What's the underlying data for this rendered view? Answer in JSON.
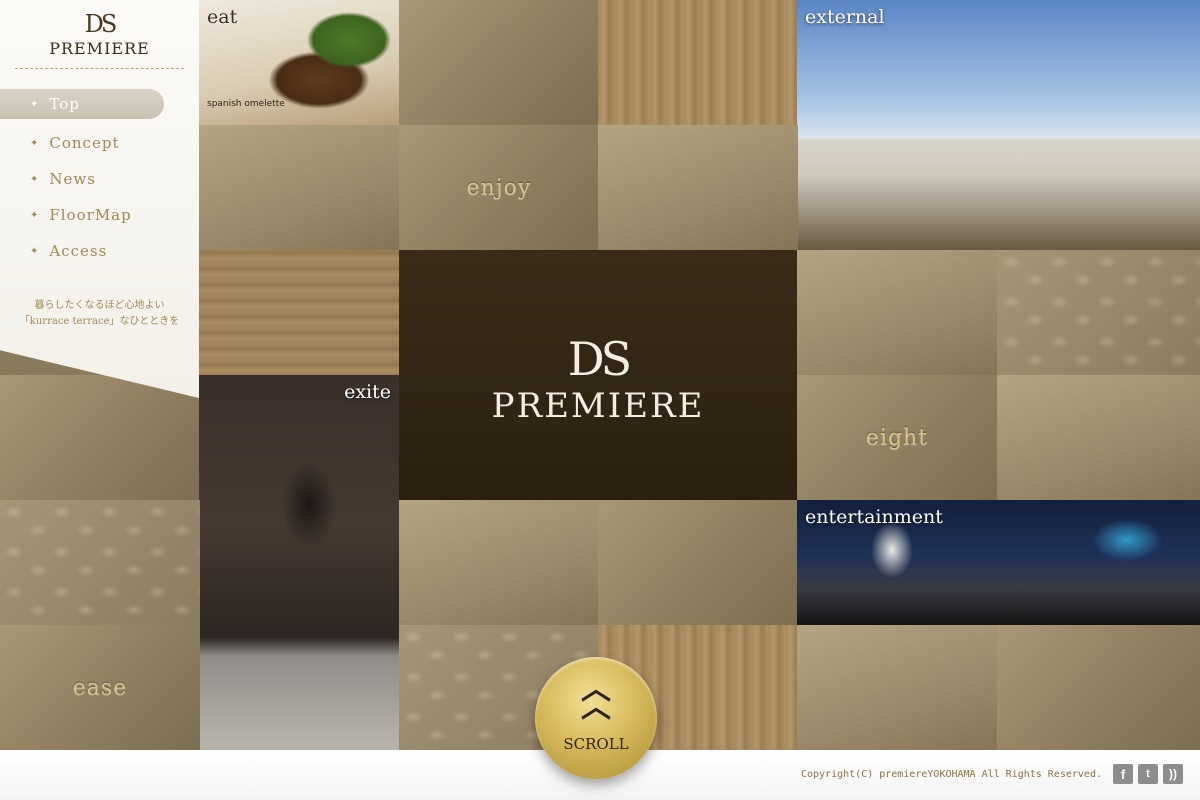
{
  "sidebar": {
    "logo_mark": "DS",
    "logo_text": "PREMIERE",
    "nav": [
      {
        "label": "Top",
        "active": true
      },
      {
        "label": "Concept"
      },
      {
        "label": "News"
      },
      {
        "label": "FloorMap"
      },
      {
        "label": "Access"
      }
    ],
    "tagline_line1": "暮らしたくなるほど心地よい",
    "tagline_line2": "「kurrace terrace」なひとときを"
  },
  "tiles": {
    "enjoy": "enjoy",
    "eight": "eight",
    "ease": "ease"
  },
  "photos": {
    "eat": {
      "label": "eat",
      "caption": "spanish omelette"
    },
    "external": {
      "label": "external"
    },
    "exite": {
      "label": "exite"
    },
    "entertainment": {
      "label": "entertainment"
    }
  },
  "center": {
    "logo_mark": "DS",
    "brand": "PREMIERE"
  },
  "scroll": {
    "label": "SCROLL",
    "chevron": "︿︿"
  },
  "footer": {
    "copyright": "Copyright(C) premiereYOKOHAMA All Rights Reserved.",
    "social": [
      "f",
      "t",
      "rss"
    ]
  },
  "colors": {
    "accent_gold": "#d7b95b",
    "dark_brown": "#2b200f",
    "nav_text": "#a08a55"
  }
}
